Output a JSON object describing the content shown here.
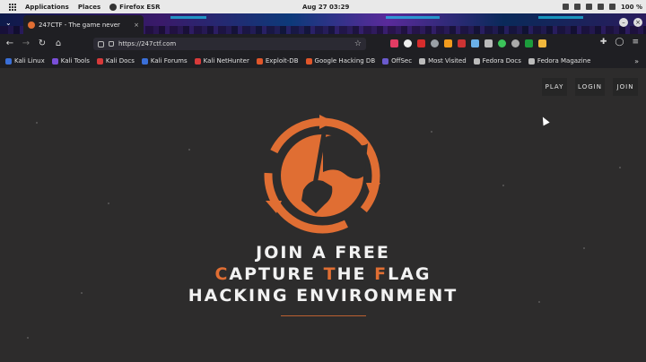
{
  "topbar": {
    "applications": "Applications",
    "places": "Places",
    "browser": "Firefox ESR",
    "clock": "Aug 27  03:29",
    "battery": "100 %"
  },
  "tab": {
    "title": "247CTF - The game never",
    "close": "×"
  },
  "navbar": {
    "url": "https://247ctf.com",
    "back_icon": "←",
    "forward_icon": "→",
    "reload_icon": "↻",
    "home_icon": "⌂"
  },
  "bookmarks": [
    {
      "label": "Kali Linux",
      "color": "#3a6fd8"
    },
    {
      "label": "Kali Tools",
      "color": "#7a4fd8"
    },
    {
      "label": "Kali Docs",
      "color": "#d83a3a"
    },
    {
      "label": "Kali Forums",
      "color": "#3a6fd8"
    },
    {
      "label": "Kali NetHunter",
      "color": "#d83a3a"
    },
    {
      "label": "Exploit-DB",
      "color": "#e0562a"
    },
    {
      "label": "Google Hacking DB",
      "color": "#e0562a"
    },
    {
      "label": "OffSec",
      "color": "#6a5acd"
    },
    {
      "label": "Most Visited",
      "color": "#bbbbbb"
    },
    {
      "label": "Fedora Docs",
      "color": "#bbbbbb"
    },
    {
      "label": "Fedora Magazine",
      "color": "#bbbbbb"
    }
  ],
  "site": {
    "play": "PLAY",
    "login": "LOGIN",
    "join": "JOIN",
    "headline": {
      "line1": "JOIN A FREE",
      "line2_c": "C",
      "line2_apture": "APTURE ",
      "line2_t": "T",
      "line2_he": "HE ",
      "line2_f": "F",
      "line2_lag": "LAG",
      "line3": "HACKING ENVIRONMENT"
    },
    "accent": "#e06e33"
  }
}
